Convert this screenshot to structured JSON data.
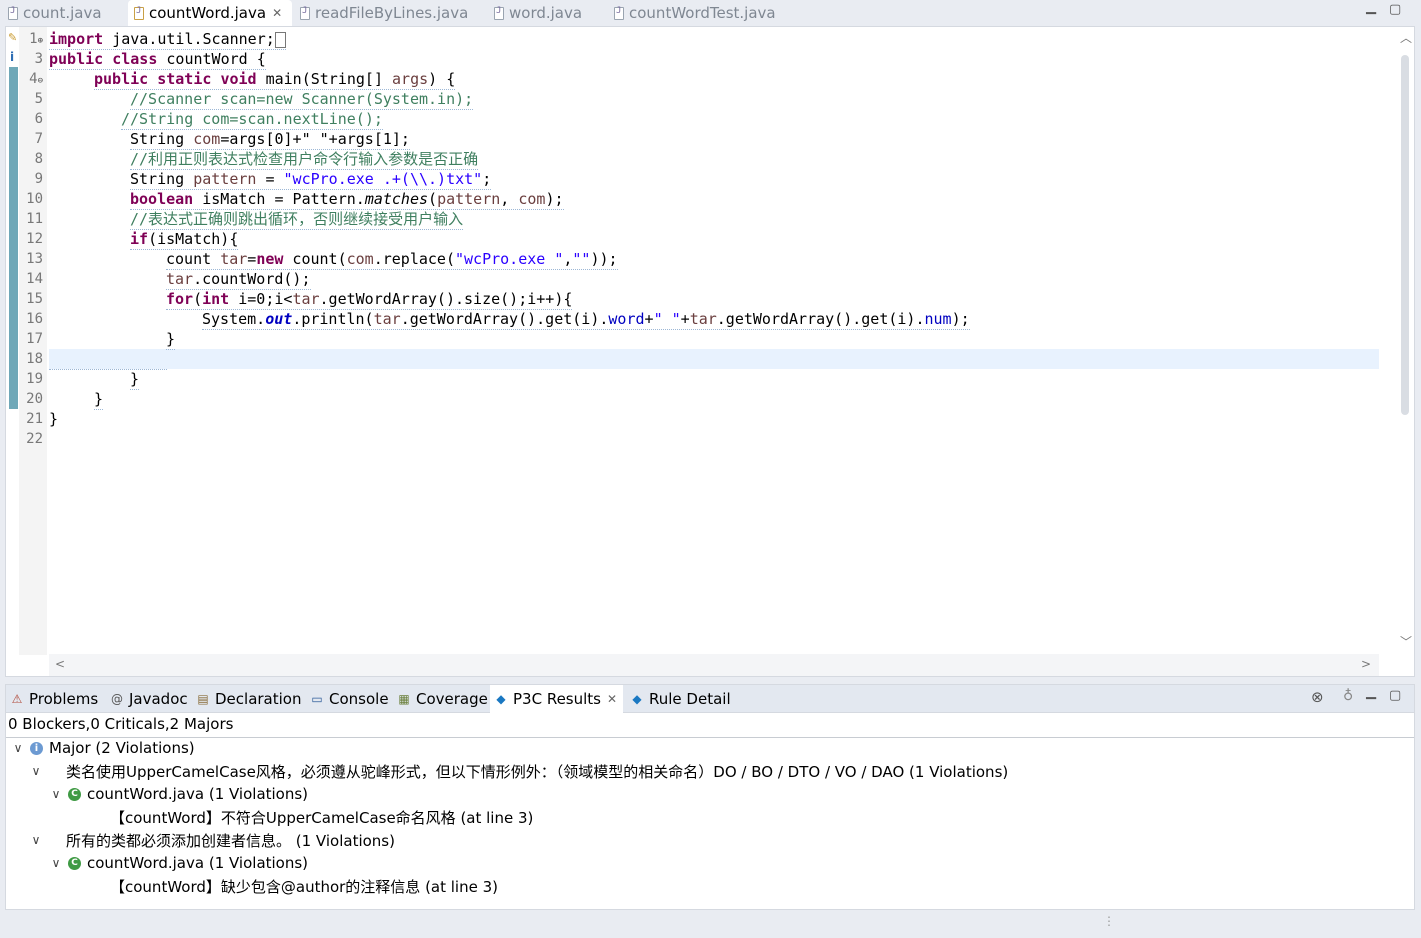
{
  "editor_tabs": [
    {
      "label": "count.java",
      "active": false
    },
    {
      "label": "countWord.java",
      "active": true
    },
    {
      "label": "readFileByLines.java",
      "active": false
    },
    {
      "label": "word.java",
      "active": false
    },
    {
      "label": "countWordTest.java",
      "active": false
    }
  ],
  "code_lines": [
    {
      "num": "1",
      "fold": "⊕"
    },
    {
      "num": "3",
      "fold": ""
    },
    {
      "num": "4",
      "fold": "⊖"
    },
    {
      "num": "5",
      "fold": ""
    },
    {
      "num": "6",
      "fold": ""
    },
    {
      "num": "7",
      "fold": ""
    },
    {
      "num": "8",
      "fold": ""
    },
    {
      "num": "9",
      "fold": ""
    },
    {
      "num": "10",
      "fold": ""
    },
    {
      "num": "11",
      "fold": ""
    },
    {
      "num": "12",
      "fold": ""
    },
    {
      "num": "13",
      "fold": ""
    },
    {
      "num": "14",
      "fold": ""
    },
    {
      "num": "15",
      "fold": ""
    },
    {
      "num": "16",
      "fold": ""
    },
    {
      "num": "17",
      "fold": ""
    },
    {
      "num": "18",
      "fold": ""
    },
    {
      "num": "19",
      "fold": ""
    },
    {
      "num": "20",
      "fold": ""
    },
    {
      "num": "21",
      "fold": ""
    },
    {
      "num": "22",
      "fold": ""
    }
  ],
  "code": {
    "l1": {
      "kw": "import",
      "rest": " java.util.Scanner;"
    },
    "l3": {
      "kw1": "public",
      "kw2": "class",
      "rest": " countWord {"
    },
    "l4": {
      "kw1": "public",
      "kw2": "static",
      "kw3": "void",
      "a": " main(String[] ",
      "v": "args",
      "b": ") {"
    },
    "l5": "//Scanner scan=new Scanner(System.in);",
    "l6": "//String com=scan.nextLine();",
    "l7": {
      "a": "String ",
      "v": "com",
      "b": "=args[0]+\" \"+args[1];"
    },
    "l8": "//利用正则表达式检查用户命令行输入参数是否正确",
    "l9": {
      "a": "String ",
      "v": "pattern",
      "b": " = ",
      "s": "\"wcPro.exe .+(\\\\.)txt\"",
      "c": ";"
    },
    "l10": {
      "kw": "boolean",
      "a": " isMatch = Pattern.",
      "m": "matches",
      "b": "(",
      "v1": "pattern",
      "c": ", ",
      "v2": "com",
      "d": ");"
    },
    "l11": "//表达式正确则跳出循环，否则继续接受用户输入",
    "l12": {
      "kw": "if",
      "rest": "(isMatch){"
    },
    "l13": {
      "a": "count ",
      "v": "tar",
      "b": "=",
      "kw": "new",
      "c": " count(",
      "v2": "com",
      "d": ".replace(",
      "s1": "\"wcPro.exe \"",
      "e": ",",
      "s2": "\"\"",
      "f": "));"
    },
    "l14": {
      "v": "tar",
      "rest": ".countWord();"
    },
    "l15": {
      "kw1": "for",
      "a": "(",
      "kw2": "int",
      "b": " i=0;i<",
      "v": "tar",
      "c": ".getWordArray().size();i++){"
    },
    "l16": {
      "a": "System.",
      "f1": "out",
      "b": ".println(",
      "v1": "tar",
      "c": ".getWordArray().get(i).",
      "f2": "word",
      "d": "+",
      "s": "\" \"",
      "e": "+",
      "v2": "tar",
      "g": ".getWordArray().get(i).",
      "f3": "num",
      "h": ");"
    },
    "l17": "}",
    "l19": "}",
    "l20": "}",
    "l21": "}"
  },
  "panel_tabs": [
    {
      "label": "Problems",
      "icon": "problems-icon",
      "glyph": "⚠",
      "active": false
    },
    {
      "label": "Javadoc",
      "icon": "javadoc-icon",
      "glyph": "@",
      "active": false
    },
    {
      "label": "Declaration",
      "icon": "declaration-icon",
      "glyph": "▤",
      "active": false
    },
    {
      "label": "Console",
      "icon": "console-icon",
      "glyph": "▭",
      "active": false
    },
    {
      "label": "Coverage",
      "icon": "coverage-icon",
      "glyph": "▦",
      "active": false
    },
    {
      "label": "P3C Results",
      "icon": "p3c-icon",
      "glyph": "◆",
      "active": true
    },
    {
      "label": "Rule Detail",
      "icon": "rule-detail-icon",
      "glyph": "◆",
      "active": false
    }
  ],
  "results": {
    "summary": "0 Blockers,0 Criticals,2 Majors",
    "major": "Major (2 Violations)",
    "rule1": "类名使用UpperCamelCase风格，必须遵从驼峰形式，但以下情形例外：（领域模型的相关命名）DO / BO / DTO / VO / DAO (1 Violations)",
    "rule1_file": "countWord.java (1 Violations)",
    "rule1_detail": "【countWord】不符合UpperCamelCase命名风格 (at line 3)",
    "rule2": "所有的类都必须添加创建者信息。 (1 Violations)",
    "rule2_file": "countWord.java (1 Violations)",
    "rule2_detail": "【countWord】缺少包含@author的注释信息 (at line 3)"
  },
  "colors": {
    "keyword": "#7f0055",
    "comment": "#3f7f5f",
    "string": "#2a00ff",
    "field": "#0000c0",
    "current_line": "#e8f2fe"
  }
}
